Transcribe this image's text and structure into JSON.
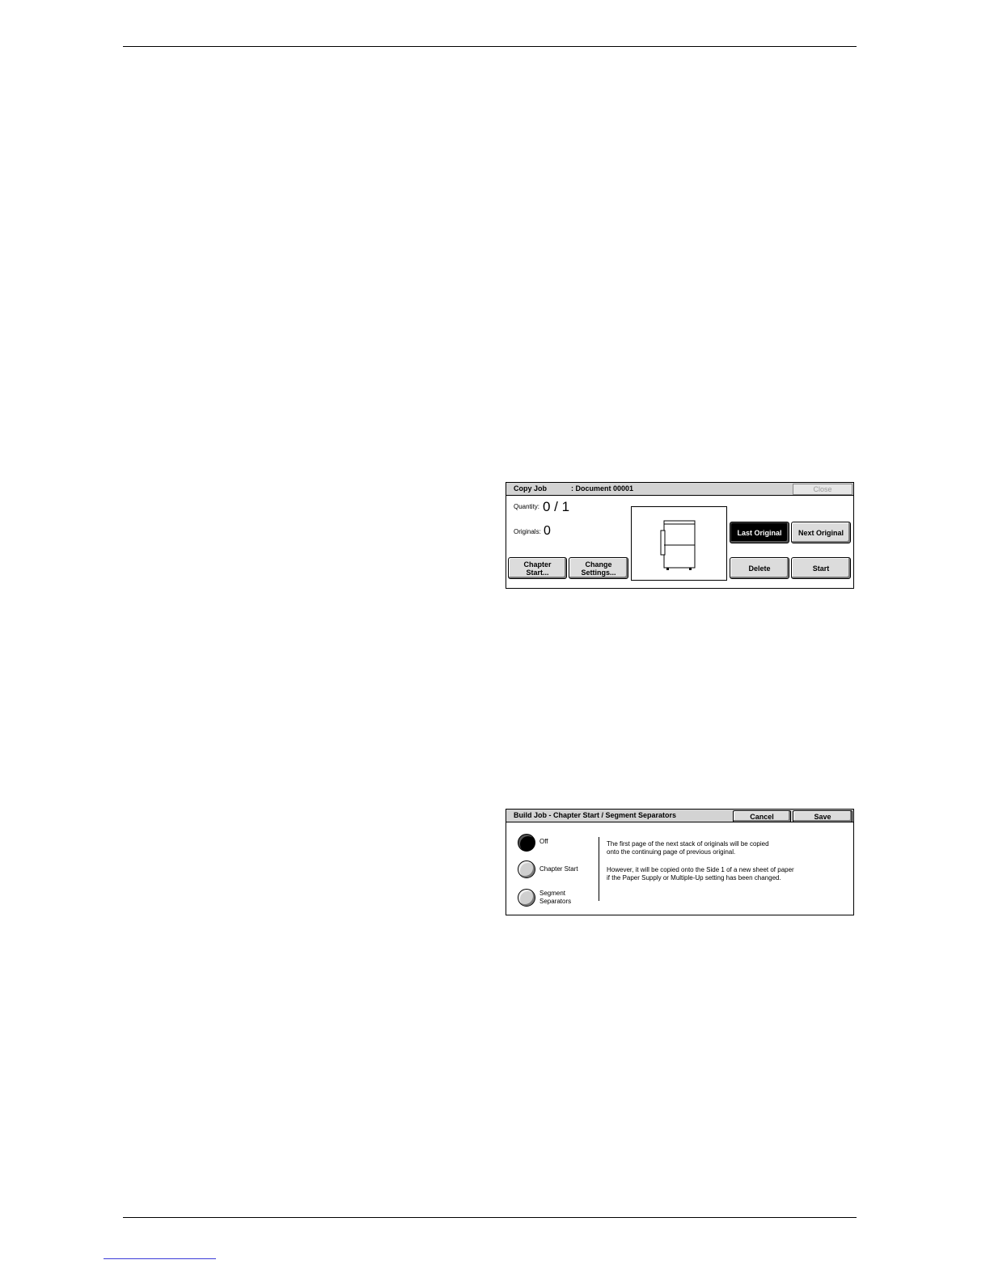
{
  "copy_job_panel": {
    "title": "Copy Job",
    "document": ": Document 00001",
    "close_label": "Close",
    "quantity_label": "Quantity:",
    "quantity_value": "0 / 1",
    "originals_label": "Originals:",
    "originals_value": "0",
    "chapter_start_label": "Chapter Start...",
    "change_settings_label": "Change Settings...",
    "last_original_label": "Last Original",
    "next_original_label": "Next Original",
    "delete_label": "Delete",
    "start_label": "Start",
    "selected": "Last Original"
  },
  "build_job_panel": {
    "title": "Build Job - Chapter Start / Segment Separators",
    "cancel_label": "Cancel",
    "save_label": "Save",
    "options": [
      {
        "label": "Off",
        "checked": true
      },
      {
        "label": "Chapter Start",
        "checked": false
      },
      {
        "label": "Segment Separators",
        "checked": false
      }
    ],
    "description_line1": "The first page of the next stack of originals will be copied",
    "description_line2": "onto the continuing page of previous original.",
    "description_line3": "However, it will be copied onto the Side 1 of a new sheet of paper",
    "description_line4": "if the Paper Supply or Multiple-Up setting has been changed."
  }
}
